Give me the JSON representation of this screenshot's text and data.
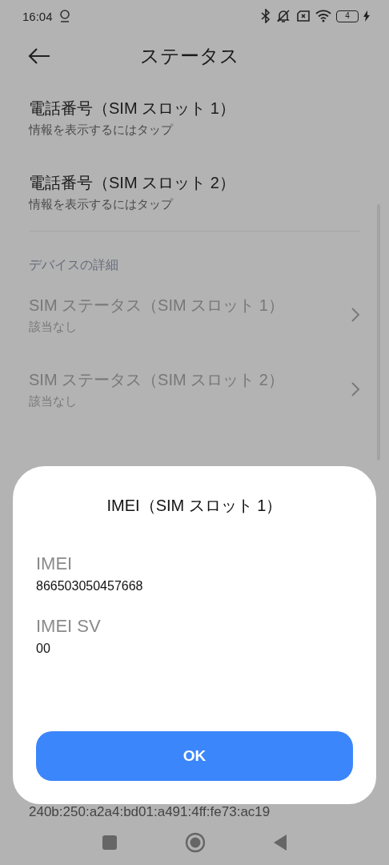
{
  "status_bar": {
    "time": "16:04",
    "battery": "4"
  },
  "header": {
    "title": "ステータス"
  },
  "items": [
    {
      "title": "電話番号（SIM スロット 1）",
      "subtitle": "情報を表示するにはタップ",
      "disabled": false,
      "chevron": false
    },
    {
      "title": "電話番号（SIM スロット 2）",
      "subtitle": "情報を表示するにはタップ",
      "disabled": false,
      "chevron": false
    }
  ],
  "device_details": {
    "label": "デバイスの詳細",
    "items": [
      {
        "title": "SIM ステータス（SIM スロット 1）",
        "subtitle": "該当なし",
        "disabled": true,
        "chevron": true
      },
      {
        "title": "SIM ステータス（SIM スロット 2）",
        "subtitle": "該当なし",
        "disabled": true,
        "chevron": true
      }
    ]
  },
  "address_line": "240b:250:a2a4:bd01:a491:4ff:fe73:ac19",
  "dialog": {
    "title": "IMEI（SIM スロット 1）",
    "fields": [
      {
        "label": "IMEI",
        "value": "866503050457668"
      },
      {
        "label": "IMEI SV",
        "value": "00"
      }
    ],
    "button": "OK"
  }
}
